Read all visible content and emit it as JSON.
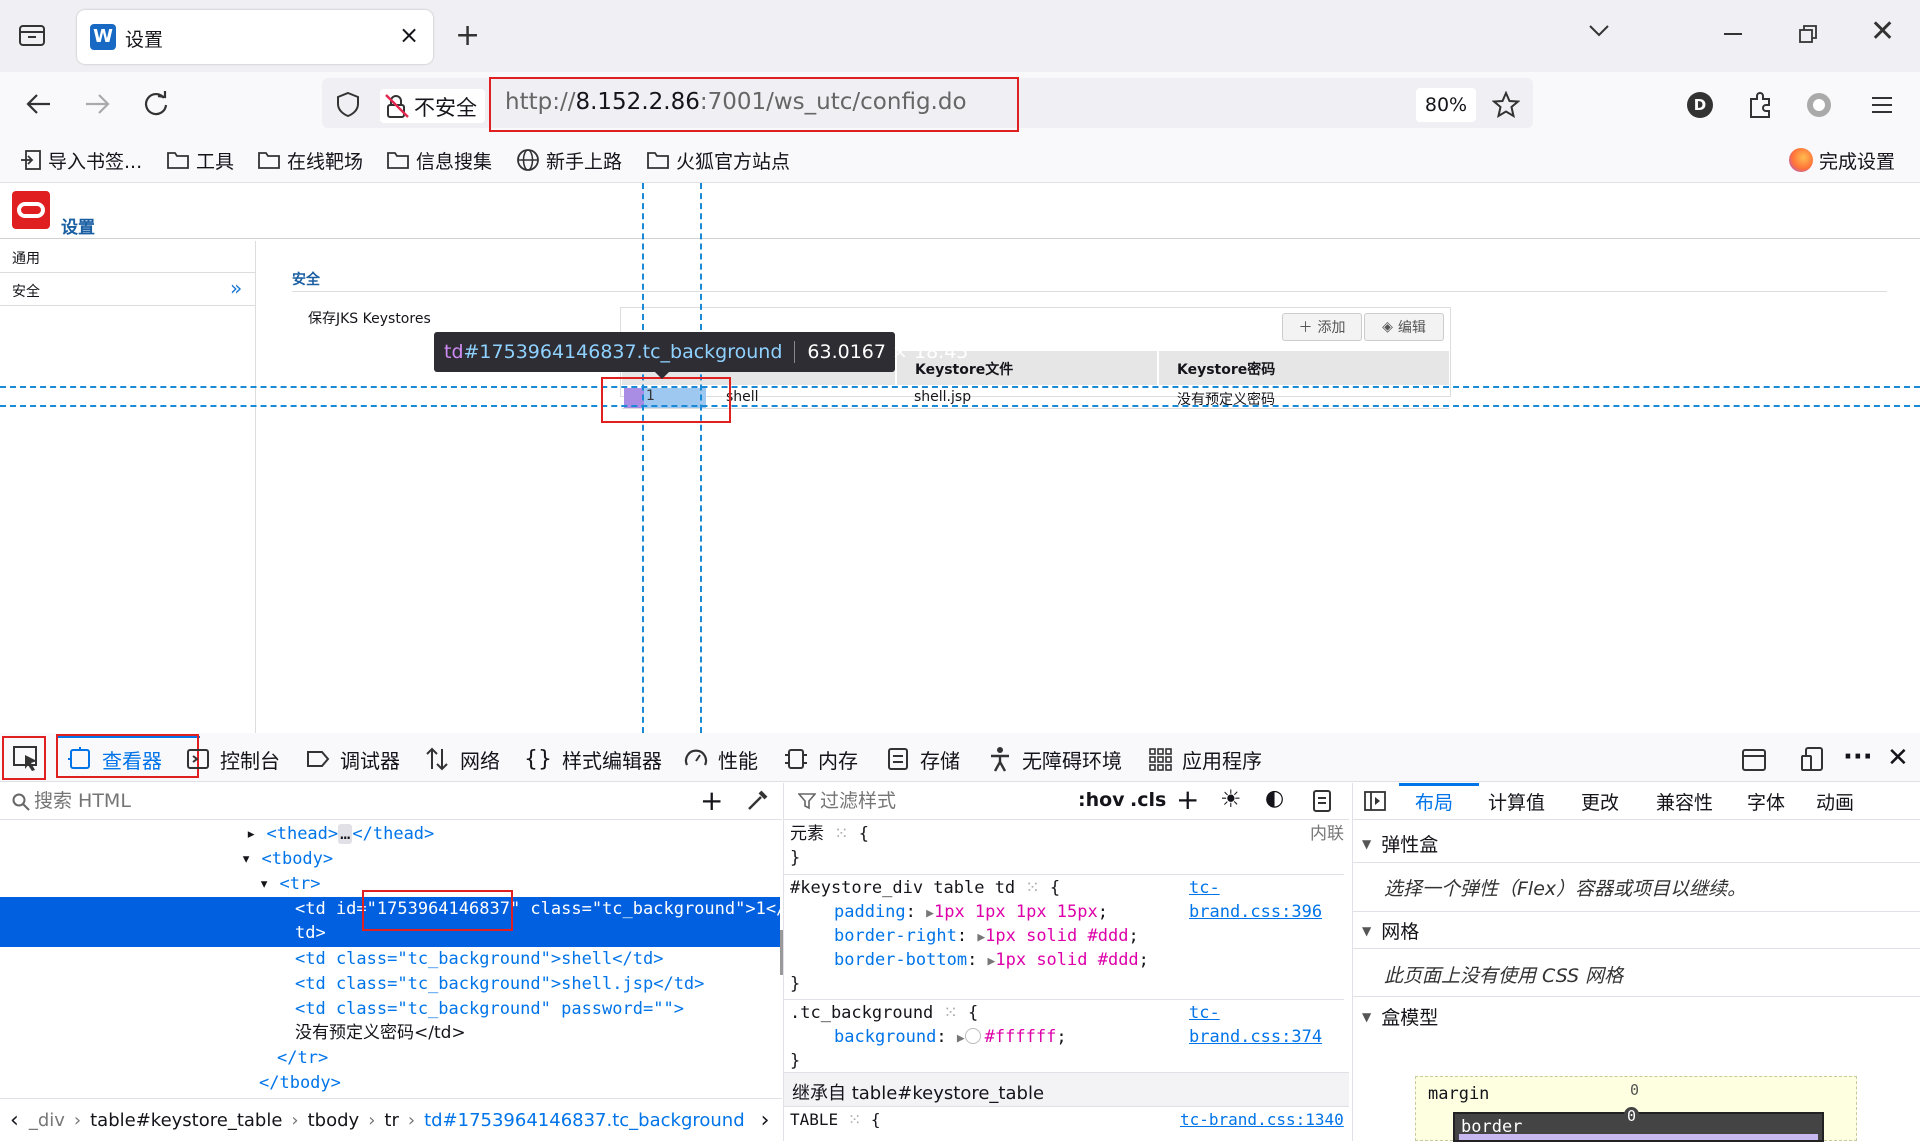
{
  "browser": {
    "tab_title": "设置",
    "new_tab_label": "+",
    "security_label": "不安全",
    "url_prefix": "http://",
    "url_host": "8.152.2.86",
    "url_rest": ":7001/ws_utc/config.do",
    "zoom": "80%",
    "profile_letter": "D"
  },
  "bookmarks": [
    {
      "label": "导入书签...",
      "icon": "import-icon"
    },
    {
      "label": "工具",
      "icon": "folder-icon"
    },
    {
      "label": "在线靶场",
      "icon": "folder-icon"
    },
    {
      "label": "信息搜集",
      "icon": "folder-icon"
    },
    {
      "label": "新手上路",
      "icon": "globe-icon"
    },
    {
      "label": "火狐官方站点",
      "icon": "folder-icon"
    }
  ],
  "bookmarks_right": "完成设置",
  "app": {
    "title": "设置",
    "sidebar": [
      "通用",
      "安全"
    ],
    "sidebar_active_chevron": "»",
    "section_title": "安全",
    "keystore_label": "保存JKS Keystores",
    "add_button": "添加",
    "edit_button": "编辑",
    "table_headers": [
      "",
      "",
      "Keystore文件",
      "Keystore密码"
    ],
    "table_row": [
      "1",
      "shell",
      "shell.jsp",
      "没有预定义密码"
    ],
    "tooltip_selector_tag": "td",
    "tooltip_selector_rest": "#1753964146837.tc_background",
    "tooltip_size": "63.0167 × 18.45"
  },
  "devtools": {
    "tabs": [
      "查看器",
      "控制台",
      "调试器",
      "网络",
      "样式编辑器",
      "性能",
      "内存",
      "存储",
      "无障碍环境",
      "应用程序"
    ],
    "search_placeholder": "搜索 HTML",
    "filter_placeholder": "过滤样式",
    "hov": ":hov",
    "cls": ".cls",
    "html_lines": {
      "thead_open": "<thead>",
      "thead_close": "</thead>",
      "tbody_open": "<tbody>",
      "tr_open": "<tr>",
      "td1_a": "<td id=\"",
      "td1_id": "1753964146837",
      "td1_b": "\" class=\"tc_background\">1</",
      "td1_c": "td>",
      "td2": "<td class=\"tc_background\">shell</td>",
      "td3": "<td class=\"tc_background\">shell.jsp</td>",
      "td4": "<td class=\"tc_background\" password=\"\">",
      "td4_text": "没有预定义密码</td>",
      "tr_close": "</tr>",
      "tbody_close": "</tbody>"
    },
    "breadcrumbs": [
      "_div",
      "table#keystore_table",
      "tbody",
      "tr",
      "td#1753964146837.tc_background"
    ],
    "rules": {
      "element_label": "元素",
      "element_origin": "内联",
      "rule1_selector": "#keystore_div table td",
      "rule1_source": "tc-brand.css:396",
      "rule1_props": [
        {
          "name": "padding",
          "value": "1px 1px 1px 15px"
        },
        {
          "name": "border-right",
          "value": "1px solid #ddd"
        },
        {
          "name": "border-bottom",
          "value": "1px solid #ddd"
        }
      ],
      "rule2_selector": ".tc_background",
      "rule2_source": "tc-brand.css:374",
      "rule2_props": [
        {
          "name": "background",
          "value": "#ffffff"
        }
      ],
      "inherited_label": "继承自 table#keystore_table",
      "rule3_selector": "TABLE",
      "rule3_source": "tc-brand.css:1340"
    },
    "layout_tabs": [
      "布局",
      "计算值",
      "更改",
      "兼容性",
      "字体",
      "动画"
    ],
    "flex_title": "弹性盒",
    "flex_msg": "选择一个弹性（Flex）容器或项目以继续。",
    "grid_title": "网格",
    "grid_msg": "此页面上没有使用 CSS 网格",
    "box_title": "盒模型",
    "box_margin": "margin",
    "box_margin_val": "0",
    "box_border": "border",
    "box_border_val": "0"
  },
  "colors": {
    "accent": "#0074e8",
    "highlight_red": "#e02020",
    "selected_row": "#0060df"
  }
}
